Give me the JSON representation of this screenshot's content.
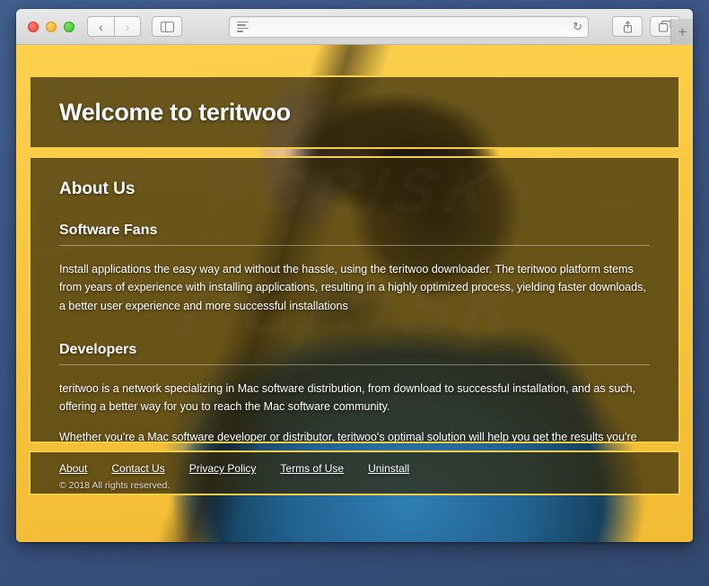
{
  "browser": {
    "window_controls": {
      "close": "close",
      "minimize": "minimize",
      "maximize": "maximize"
    },
    "back_label": "‹",
    "forward_label": "›",
    "sidebar_label": "▤",
    "address_value": "",
    "address_placeholder": "",
    "reload_label": "↻",
    "share_label": "⇧",
    "tabs_label": "⧉",
    "newtab_label": "+"
  },
  "page": {
    "hero_title": "Welcome to teritwoo",
    "about_heading": "About Us",
    "sections": [
      {
        "title": "Software Fans",
        "paragraphs": [
          "Install applications the easy way and without the hassle, using the teritwoo downloader. The teritwoo platform stems from years of experience with installing applications, resulting in a highly optimized process, yielding faster downloads, a better user experience and more successful installations"
        ]
      },
      {
        "title": "Developers",
        "paragraphs": [
          "teritwoo is a network specializing in Mac software distribution, from download to successful installation, and as such, offering a better way for you to reach the Mac software community.",
          "Whether you're a Mac software developer or distributor, teritwoo's optimal solution will help you get the results you're looking for, providing you with detailed insights into the installation process and better engagement with your audience, leading to higher revenues."
        ]
      }
    ],
    "footer": {
      "links": [
        {
          "label": "About"
        },
        {
          "label": "Contact Us"
        },
        {
          "label": "Privacy Policy"
        },
        {
          "label": "Terms of Use"
        },
        {
          "label": "Uninstall"
        }
      ],
      "copyright": "© 2018 All rights reserved."
    },
    "watermark": {
      "top": "PCRISK",
      "main": "PCRISK"
    }
  },
  "colors": {
    "accent_gold": "#f5cf4c",
    "panel_overlay": "rgba(50,40,10,0.72)",
    "desktop": "#3d5a8a",
    "wall_yellow": "#f8c63f",
    "denim_blue": "#22618f"
  }
}
